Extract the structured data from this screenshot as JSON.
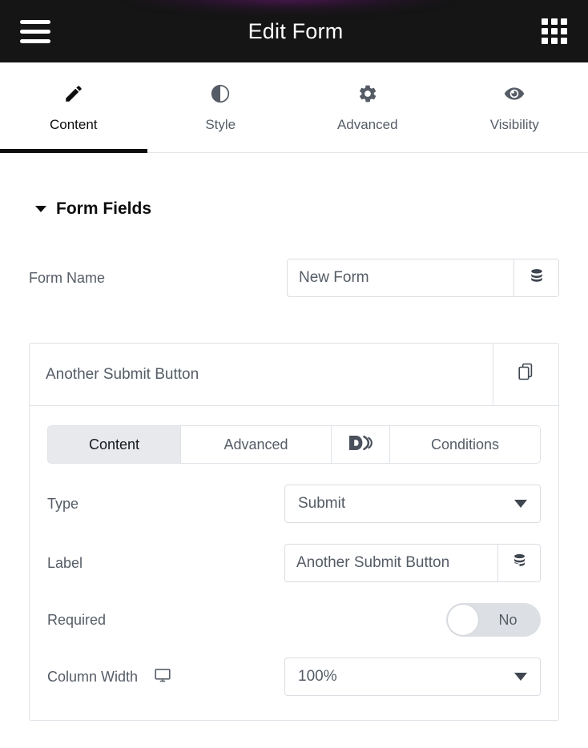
{
  "appbar": {
    "menu_icon": "hamburger-menu-icon",
    "title": "Edit Form",
    "apps_icon": "grid-apps-icon"
  },
  "main_tabs": [
    {
      "label": "Content",
      "icon": "pencil-icon",
      "active": true
    },
    {
      "label": "Style",
      "icon": "contrast-icon",
      "active": false
    },
    {
      "label": "Advanced",
      "icon": "gear-icon",
      "active": false
    },
    {
      "label": "Visibility",
      "icon": "eye-icon",
      "active": false
    }
  ],
  "section": {
    "title": "Form Fields",
    "collapse_icon": "caret-down-icon"
  },
  "form_name": {
    "label": "Form Name",
    "value": "New Form",
    "placeholder": "Form Name",
    "dynamic_icon": "database-stack-icon"
  },
  "field_card": {
    "title": "Another Submit Button",
    "duplicate_icon": "copy-duplicate-icon",
    "tabs": [
      {
        "label": "Content",
        "active": true,
        "icon": null
      },
      {
        "label": "Advanced",
        "active": false,
        "icon": null
      },
      {
        "label": "",
        "active": false,
        "icon": "dynamic-d-logo-icon"
      },
      {
        "label": "Conditions",
        "active": false,
        "icon": null
      }
    ],
    "type": {
      "label": "Type",
      "value": "Submit",
      "caret_icon": "chevron-down-icon"
    },
    "label_field": {
      "label": "Label",
      "value": "Another Submit Button",
      "placeholder": "Label",
      "dynamic_icon": "database-stack-icon"
    },
    "required": {
      "label": "Required",
      "state_text": "No",
      "checked": false
    },
    "column_width": {
      "label": "Column Width",
      "device_icon": "desktop-monitor-icon",
      "value": "100%",
      "caret_icon": "chevron-down-icon"
    }
  },
  "colors": {
    "appbar_bg": "#151515",
    "accent_underline": "#0d0d0d",
    "text_muted": "#555c66",
    "border": "#dfe2e7",
    "tab_active_bg": "#e7e9ec",
    "toggle_off": "#dcdfe4"
  }
}
